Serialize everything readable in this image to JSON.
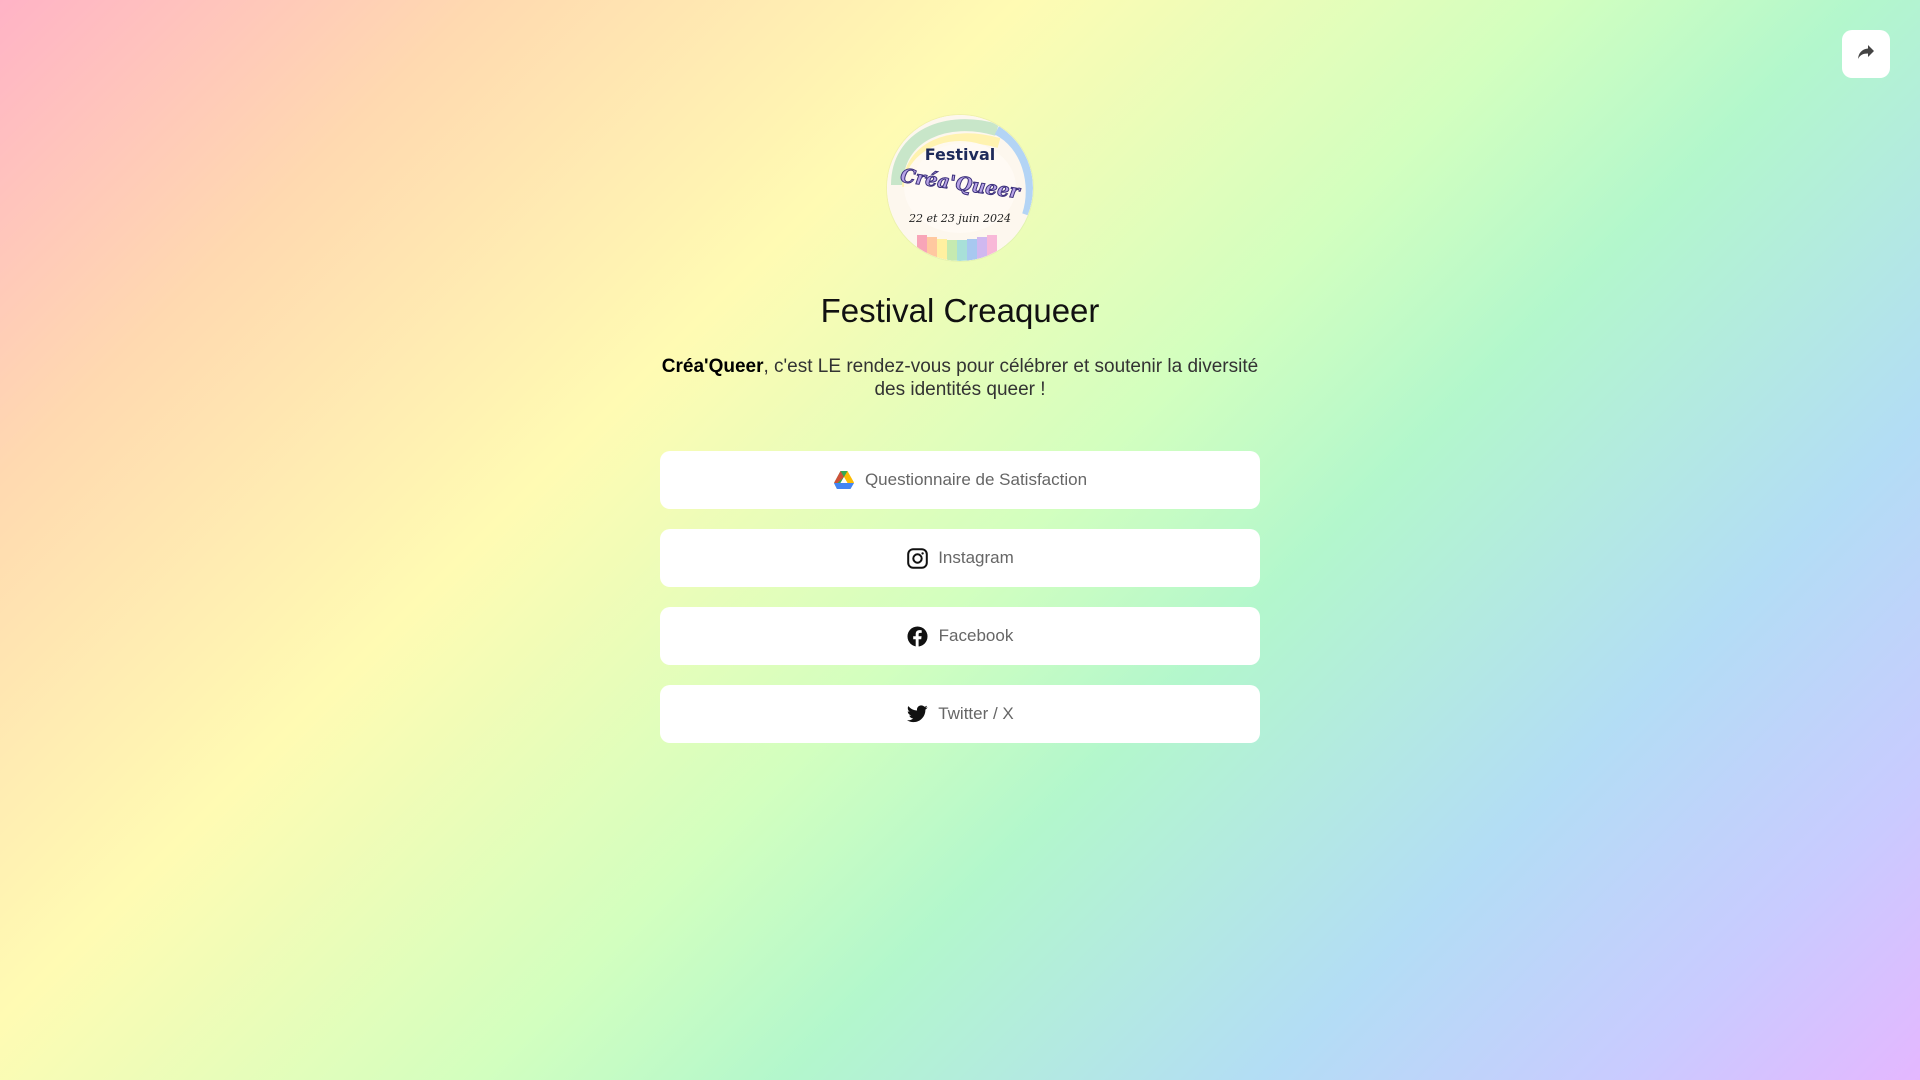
{
  "share": {
    "icon": "share-arrow-icon"
  },
  "profile": {
    "avatar_text": {
      "top": "Festival",
      "middle": "Créa'Queer",
      "bottom": "22 et 23 juin 2024"
    },
    "title": "Festival Creaqueer",
    "description_strong": "Créa'Queer",
    "description_rest": ", c'est LE rendez-vous pour célébrer et soutenir la diversité des identités queer !"
  },
  "links": [
    {
      "label": "Questionnaire de Satisfaction",
      "icon": "google-drive-icon"
    },
    {
      "label": "Instagram",
      "icon": "instagram-icon"
    },
    {
      "label": "Facebook",
      "icon": "facebook-icon"
    },
    {
      "label": "Twitter / X",
      "icon": "twitter-icon"
    }
  ]
}
